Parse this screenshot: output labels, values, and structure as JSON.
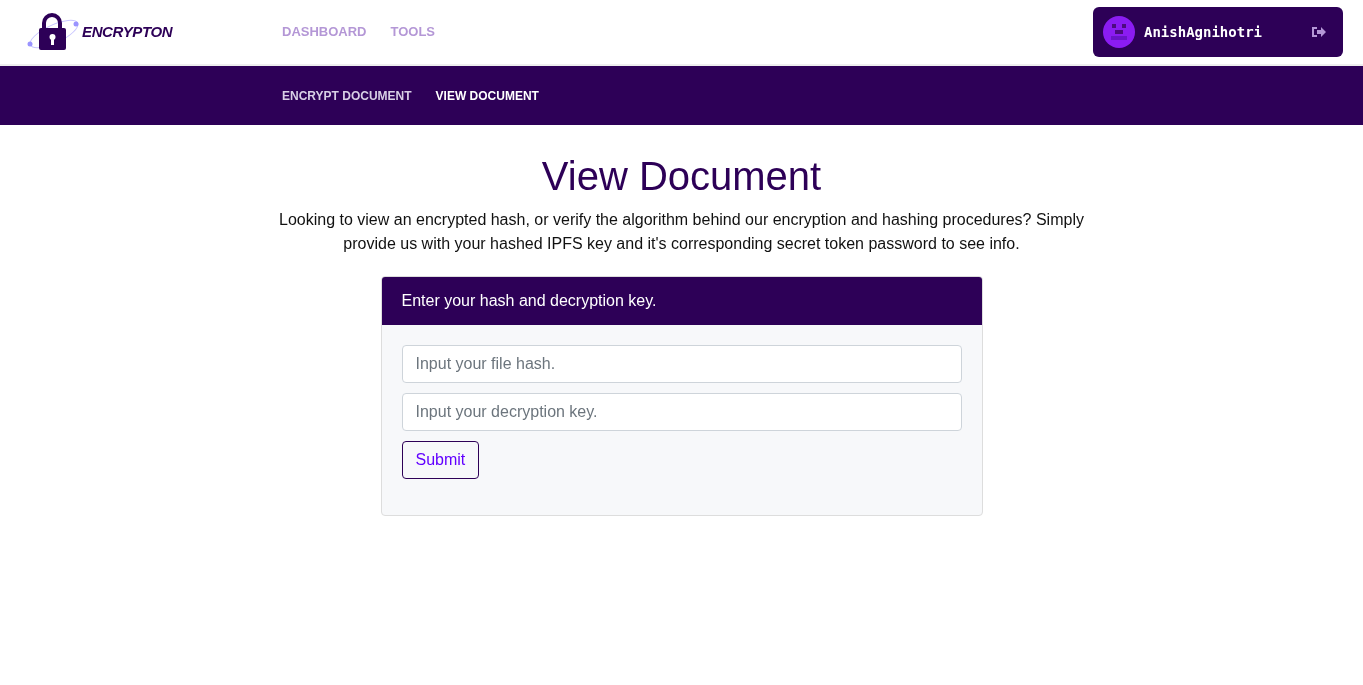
{
  "brand": {
    "name": "ENCRYPTON"
  },
  "nav": [
    {
      "label": "DASHBOARD",
      "selected": false
    },
    {
      "label": "TOOLS",
      "selected": false
    }
  ],
  "user": {
    "name": "AnishAgnihotri"
  },
  "subnav": [
    {
      "label": "ENCRYPT DOCUMENT",
      "selected": false
    },
    {
      "label": "VIEW DOCUMENT",
      "selected": true
    }
  ],
  "page": {
    "title": "View Document",
    "description": "Looking to view an encrypted hash, or verify the algorithm behind our encryption and hashing procedures? Simply provide us with your hashed IPFS key and it's corresponding secret token password to see info."
  },
  "form": {
    "header": "Enter your hash and decryption key.",
    "fields": [
      {
        "placeholder": "Input your file hash."
      },
      {
        "placeholder": "Input your decryption key."
      }
    ],
    "submit": "Submit"
  }
}
